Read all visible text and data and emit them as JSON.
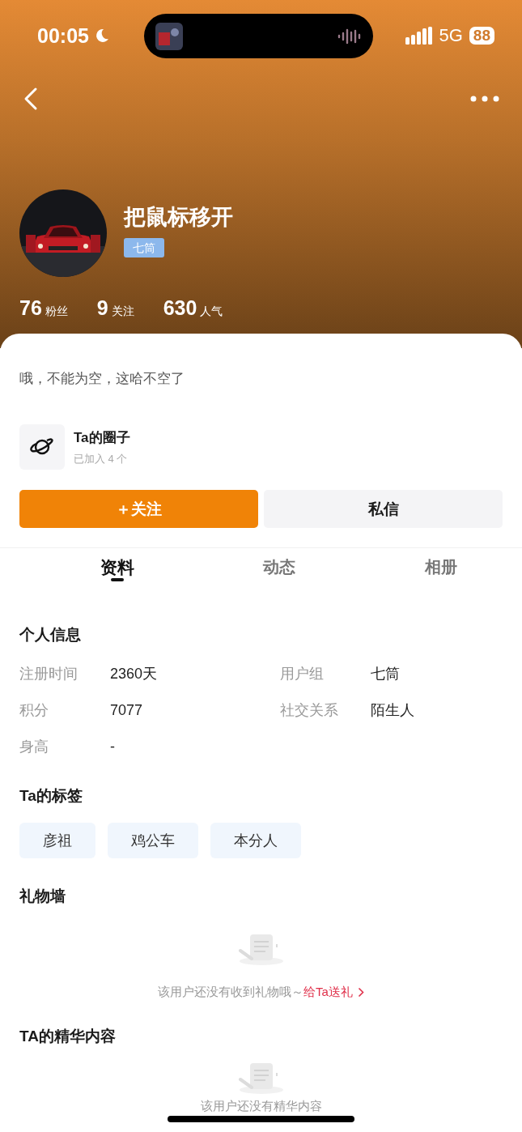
{
  "status_bar": {
    "time": "00:05",
    "network": "5G",
    "battery": "88"
  },
  "profile": {
    "name": "把鼠标移开",
    "badge": "七筒",
    "stats": [
      {
        "value": "76",
        "label": "粉丝"
      },
      {
        "value": "9",
        "label": "关注"
      },
      {
        "value": "630",
        "label": "人气"
      }
    ]
  },
  "bio": "哦，不能为空，这哈不空了",
  "circle": {
    "title": "Ta的圈子",
    "subtitle": "已加入 4 个"
  },
  "buttons": [
    {
      "label": "＋关注",
      "kind": "primary"
    },
    {
      "label": "私信",
      "kind": "secondary"
    }
  ],
  "tabs": [
    {
      "label": "资料",
      "selected": true
    },
    {
      "label": "动态",
      "selected": false
    },
    {
      "label": "相册",
      "selected": false
    }
  ],
  "info_section": {
    "title": "个人信息",
    "items": [
      {
        "label": "注册时间",
        "value": "2360天"
      },
      {
        "label": "用户组",
        "value": "七筒"
      },
      {
        "label": "积分",
        "value": "7077"
      },
      {
        "label": "社交关系",
        "value": "陌生人"
      },
      {
        "label": "身高",
        "value": "-"
      }
    ]
  },
  "tags_section": {
    "title": "Ta的标签",
    "tags": [
      "彦祖",
      "鸡公车",
      "本分人"
    ]
  },
  "gift_wall": {
    "title": "礼物墙",
    "empty_text": "该用户还没有收到礼物哦～",
    "link": "给Ta送礼"
  },
  "featured": {
    "title": "TA的精华内容",
    "empty_text": "该用户还没有精华内容"
  }
}
